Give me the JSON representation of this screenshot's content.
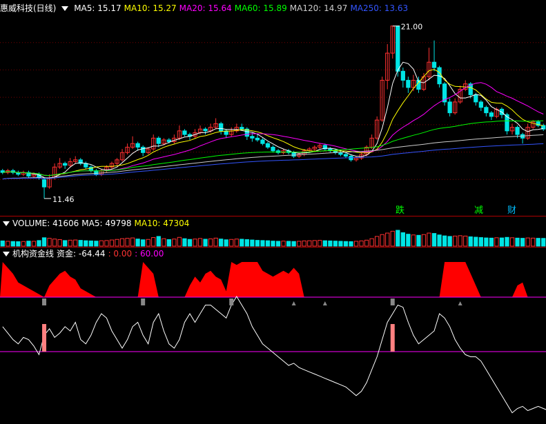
{
  "header": {
    "stock": "惠威科技(日线)",
    "ma": [
      {
        "label": "MA5: 15.17",
        "color": "#ffffff"
      },
      {
        "label": "MA10: 15.27",
        "color": "#ffff00"
      },
      {
        "label": "MA20: 15.64",
        "color": "#ff00ff"
      },
      {
        "label": "MA60: 15.89",
        "color": "#00ff00"
      },
      {
        "label": "MA120: 14.97",
        "color": "#cccccc"
      },
      {
        "label": "MA250: 13.63",
        "color": "#3355ff"
      }
    ]
  },
  "volume_header": {
    "items": [
      {
        "label": "VOLUME: 41606",
        "color": "#ffffff"
      },
      {
        "label": "MA5: 49798",
        "color": "#ffffff"
      },
      {
        "label": "MA10: 47304",
        "color": "#ffff00"
      }
    ]
  },
  "indicator_header": {
    "items": [
      {
        "label": "机构资金线",
        "color": "#ffffff"
      },
      {
        "label": "资金: -64.44",
        "color": "#ffffff"
      },
      {
        "label": ": 0.00",
        "color": "#ff3333"
      },
      {
        "label": ": 60.00",
        "color": "#ff00ff"
      }
    ]
  },
  "annotations": {
    "high": "21.00",
    "low": "11.46"
  },
  "tags": [
    {
      "text": "跌",
      "color": "#00ff00"
    },
    {
      "text": "减",
      "color": "#00ff00"
    },
    {
      "text": "财",
      "color": "#00bfff"
    }
  ],
  "colors": {
    "up": "#ff3030",
    "down": "#00e5e5",
    "grid": "#7a0000"
  },
  "chart_data": {
    "type": "candlestick",
    "price_range": [
      11.0,
      21.6
    ],
    "candles": [
      [
        13.0,
        12.9,
        13.1,
        12.8
      ],
      [
        12.9,
        13.0,
        13.1,
        12.8
      ],
      [
        13.0,
        12.9,
        13.1,
        12.8
      ],
      [
        12.9,
        12.8,
        13.0,
        12.7
      ],
      [
        12.8,
        12.9,
        13.0,
        12.7
      ],
      [
        12.9,
        12.7,
        13.0,
        12.6
      ],
      [
        12.7,
        12.8,
        12.9,
        12.6
      ],
      [
        12.8,
        12.6,
        12.9,
        12.5
      ],
      [
        12.5,
        12.1,
        12.6,
        11.46
      ],
      [
        12.1,
        12.6,
        12.8,
        12.0
      ],
      [
        12.6,
        13.2,
        13.4,
        12.5
      ],
      [
        13.2,
        13.4,
        13.7,
        13.1
      ],
      [
        13.4,
        13.3,
        13.5,
        13.1
      ],
      [
        13.3,
        13.5,
        13.7,
        13.2
      ],
      [
        13.5,
        13.6,
        13.8,
        13.4
      ],
      [
        13.6,
        13.4,
        13.7,
        13.3
      ],
      [
        13.4,
        13.2,
        13.5,
        13.1
      ],
      [
        13.2,
        13.0,
        13.3,
        12.9
      ],
      [
        13.0,
        12.8,
        13.1,
        12.7
      ],
      [
        12.8,
        13.0,
        13.1,
        12.7
      ],
      [
        13.0,
        13.2,
        13.3,
        12.9
      ],
      [
        13.2,
        13.4,
        13.5,
        13.1
      ],
      [
        13.4,
        13.6,
        13.7,
        13.3
      ],
      [
        13.6,
        14.0,
        14.2,
        13.5
      ],
      [
        14.0,
        14.3,
        14.5,
        13.9
      ],
      [
        14.3,
        14.5,
        14.9,
        14.2
      ],
      [
        14.5,
        14.3,
        14.6,
        14.1
      ],
      [
        14.3,
        14.0,
        14.4,
        13.8
      ],
      [
        14.0,
        14.2,
        14.3,
        13.9
      ],
      [
        14.2,
        14.8,
        15.0,
        14.1
      ],
      [
        14.8,
        14.5,
        14.9,
        14.3
      ],
      [
        14.5,
        14.7,
        14.8,
        14.4
      ],
      [
        14.7,
        14.6,
        14.8,
        14.5
      ],
      [
        14.6,
        14.8,
        15.0,
        14.5
      ],
      [
        14.8,
        15.2,
        15.5,
        14.7
      ],
      [
        15.2,
        15.0,
        15.3,
        14.9
      ],
      [
        15.0,
        14.9,
        15.1,
        14.7
      ],
      [
        14.9,
        15.1,
        15.3,
        14.8
      ],
      [
        15.1,
        15.3,
        15.5,
        15.0
      ],
      [
        15.3,
        15.2,
        15.4,
        15.0
      ],
      [
        15.2,
        15.4,
        15.6,
        15.1
      ],
      [
        15.4,
        15.6,
        15.9,
        15.3
      ],
      [
        15.6,
        15.2,
        15.7,
        15.0
      ],
      [
        15.2,
        15.0,
        15.3,
        14.8
      ],
      [
        15.0,
        15.2,
        15.4,
        14.9
      ],
      [
        15.2,
        15.4,
        15.6,
        15.1
      ],
      [
        15.4,
        15.3,
        15.6,
        15.2
      ],
      [
        15.3,
        14.9,
        15.4,
        14.7
      ],
      [
        14.9,
        14.8,
        15.1,
        14.6
      ],
      [
        14.8,
        14.7,
        15.0,
        14.6
      ],
      [
        14.7,
        14.5,
        14.8,
        14.4
      ],
      [
        14.5,
        14.3,
        14.6,
        14.2
      ],
      [
        14.3,
        14.1,
        14.4,
        14.0
      ],
      [
        14.1,
        14.0,
        14.2,
        13.9
      ],
      [
        14.0,
        14.1,
        14.2,
        13.9
      ],
      [
        14.1,
        14.0,
        14.2,
        13.9
      ],
      [
        14.0,
        13.8,
        14.1,
        13.7
      ],
      [
        13.8,
        13.9,
        14.0,
        13.7
      ],
      [
        13.9,
        14.1,
        14.2,
        13.8
      ],
      [
        14.1,
        14.2,
        14.3,
        14.0
      ],
      [
        14.2,
        14.3,
        14.4,
        14.1
      ],
      [
        14.3,
        14.4,
        14.5,
        14.2
      ],
      [
        14.4,
        14.2,
        14.5,
        14.1
      ],
      [
        14.2,
        14.1,
        14.3,
        14.0
      ],
      [
        14.1,
        14.0,
        14.2,
        13.9
      ],
      [
        14.0,
        13.9,
        14.1,
        13.8
      ],
      [
        13.9,
        13.8,
        14.0,
        13.7
      ],
      [
        13.8,
        13.6,
        13.9,
        13.5
      ],
      [
        13.6,
        13.7,
        13.8,
        13.5
      ],
      [
        13.7,
        13.9,
        14.0,
        13.6
      ],
      [
        13.9,
        14.3,
        14.4,
        13.8
      ],
      [
        14.3,
        14.8,
        15.0,
        14.2
      ],
      [
        14.8,
        15.8,
        16.0,
        14.7
      ],
      [
        15.8,
        18.0,
        18.2,
        15.7
      ],
      [
        18.0,
        19.5,
        20.0,
        17.5
      ],
      [
        19.5,
        21.0,
        21.0,
        19.2
      ],
      [
        21.0,
        18.5,
        21.0,
        18.2
      ],
      [
        18.5,
        18.0,
        18.7,
        17.6
      ],
      [
        18.0,
        17.6,
        18.2,
        17.3
      ],
      [
        17.6,
        18.0,
        18.3,
        17.4
      ],
      [
        18.0,
        17.5,
        18.2,
        17.3
      ],
      [
        17.5,
        18.2,
        18.4,
        17.4
      ],
      [
        18.2,
        19.0,
        19.8,
        18.0
      ],
      [
        19.0,
        18.7,
        20.2,
        18.5
      ],
      [
        18.7,
        17.8,
        18.8,
        17.6
      ],
      [
        17.8,
        16.8,
        17.9,
        16.6
      ],
      [
        16.8,
        16.2,
        17.0,
        16.0
      ],
      [
        16.2,
        16.8,
        17.0,
        16.1
      ],
      [
        16.8,
        17.5,
        17.7,
        16.7
      ],
      [
        17.5,
        17.8,
        18.0,
        17.4
      ],
      [
        17.8,
        17.2,
        17.9,
        17.0
      ],
      [
        17.2,
        16.8,
        17.3,
        16.6
      ],
      [
        16.8,
        16.5,
        16.9,
        16.3
      ],
      [
        16.5,
        16.2,
        16.6,
        16.0
      ],
      [
        16.2,
        16.0,
        16.3,
        15.8
      ],
      [
        16.0,
        16.4,
        16.5,
        15.9
      ],
      [
        16.4,
        16.1,
        16.5,
        15.9
      ],
      [
        16.1,
        15.2,
        16.2,
        15.0
      ],
      [
        15.2,
        15.4,
        15.6,
        15.0
      ],
      [
        15.4,
        15.0,
        15.5,
        14.8
      ],
      [
        15.0,
        14.8,
        15.1,
        14.5
      ],
      [
        14.8,
        15.4,
        15.6,
        14.7
      ],
      [
        15.4,
        15.7,
        15.8,
        15.3
      ],
      [
        15.7,
        15.5,
        15.8,
        15.4
      ],
      [
        15.5,
        15.3,
        15.6,
        15.2
      ]
    ],
    "volume": [
      28000,
      26000,
      25000,
      24000,
      25000,
      27000,
      26000,
      30000,
      45000,
      42000,
      38000,
      35000,
      30000,
      32000,
      33000,
      31000,
      29000,
      28000,
      27000,
      29000,
      30000,
      33000,
      36000,
      40000,
      42000,
      44000,
      38000,
      34000,
      36000,
      46000,
      52000,
      40000,
      35000,
      38000,
      47000,
      40000,
      36000,
      38000,
      41000,
      37000,
      39000,
      43000,
      38000,
      34000,
      36000,
      38000,
      37000,
      35000,
      33000,
      31000,
      30000,
      29000,
      27000,
      26000,
      27000,
      26000,
      25000,
      26000,
      28000,
      29000,
      30000,
      31000,
      29000,
      28000,
      27000,
      26000,
      25000,
      24000,
      26000,
      28000,
      32000,
      40000,
      52000,
      62000,
      70000,
      80000,
      85000,
      72000,
      64000,
      60000,
      58000,
      62000,
      70000,
      68000,
      60000,
      55000,
      52000,
      54000,
      56000,
      54000,
      50000,
      48000,
      46000,
      44000,
      43000,
      45000,
      44000,
      47000,
      45000,
      43000,
      42000,
      44000,
      43000,
      42000,
      41606
    ],
    "zijin_fill": [
      60,
      50,
      40,
      25,
      20,
      15,
      10,
      5,
      0,
      20,
      30,
      40,
      45,
      35,
      30,
      15,
      10,
      5,
      0,
      0,
      0,
      0,
      0,
      0,
      0,
      0,
      0,
      60,
      50,
      40,
      0,
      0,
      0,
      0,
      0,
      0,
      20,
      35,
      25,
      40,
      45,
      35,
      30,
      10,
      60,
      55,
      60,
      60,
      60,
      60,
      45,
      40,
      35,
      40,
      45,
      40,
      50,
      40,
      0,
      0,
      0,
      0,
      0,
      0,
      0,
      0,
      0,
      0,
      0,
      0,
      0,
      0,
      0,
      0,
      0,
      0,
      0,
      0,
      0,
      0,
      0,
      0,
      0,
      0,
      0,
      60,
      60,
      60,
      60,
      60,
      40,
      20,
      0,
      0,
      0,
      0,
      0,
      0,
      0,
      20,
      25,
      0,
      0,
      0,
      0,
      0,
      0,
      0,
      0
    ],
    "zijin_line": [
      10,
      -5,
      -20,
      -30,
      -15,
      -20,
      -35,
      -55,
      -10,
      5,
      -15,
      -5,
      10,
      0,
      20,
      -20,
      -30,
      -10,
      20,
      40,
      30,
      0,
      -20,
      -40,
      -20,
      10,
      20,
      -10,
      -30,
      20,
      40,
      0,
      -30,
      -40,
      -20,
      20,
      40,
      20,
      40,
      60,
      60,
      50,
      40,
      30,
      60,
      80,
      60,
      40,
      10,
      -10,
      -30,
      -40,
      -50,
      -60,
      -70,
      -80,
      -75,
      -85,
      -90,
      -95,
      -100,
      -105,
      -110,
      -115,
      -120,
      -125,
      -130,
      -140,
      -150,
      -140,
      -120,
      -90,
      -60,
      -20,
      20,
      40,
      60,
      55,
      20,
      -10,
      -30,
      -20,
      -10,
      0,
      40,
      30,
      10,
      -20,
      -40,
      -55,
      -60,
      -60,
      -70,
      -90,
      -110,
      -130,
      -150,
      -170,
      -190,
      -180,
      -175,
      -185,
      -180,
      -175,
      -180,
      -185,
      -180,
      -64.44
    ],
    "ma_series": [
      {
        "name": "MA5",
        "color": "#ffffff"
      },
      {
        "name": "MA10",
        "color": "#ffff00"
      },
      {
        "name": "MA20",
        "color": "#ff00ff"
      },
      {
        "name": "MA60",
        "color": "#00ff00"
      },
      {
        "name": "MA120",
        "color": "#cccccc"
      },
      {
        "name": "MA250",
        "color": "#3355ff"
      }
    ]
  }
}
